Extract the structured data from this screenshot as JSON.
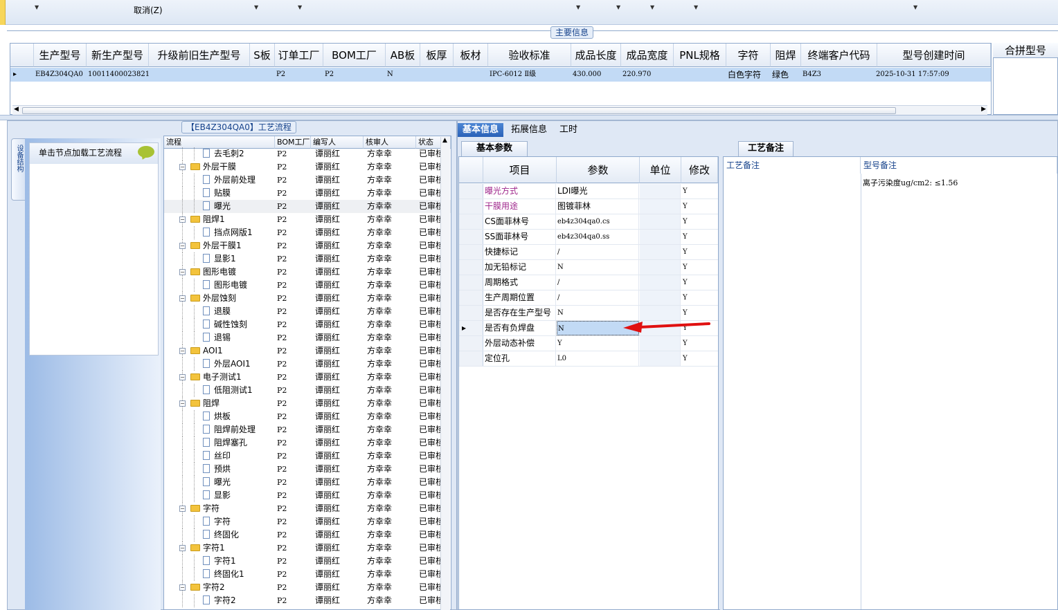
{
  "toolbar": {
    "cancel_label": "取消(Z)"
  },
  "main_info": {
    "caption": "主要信息",
    "columns": [
      "生产型号",
      "新生产型号",
      "升级前旧生产型号",
      "S板",
      "订单工厂",
      "BOM工厂",
      "AB板",
      "板厚",
      "板材",
      "验收标准",
      "成品长度",
      "成品宽度",
      "PNL规格",
      "字符",
      "阻焊",
      "终端客户代码",
      "型号创建时间"
    ],
    "row": {
      "生产型号": "EB4Z304QA0",
      "新生产型号": "10011400023821",
      "升级前旧生产型号": "",
      "S板": "",
      "订单工厂": "P2",
      "BOM工厂": "P2",
      "AB板": "N",
      "板厚": "",
      "板材": "",
      "验收标准": "IPC-6012 Ⅱ级",
      "成品长度": "430.000",
      "成品宽度": "220.970",
      "PNL规格": "",
      "字符": "白色字符",
      "阻焊": "绿色",
      "终端客户代码": "B4Z3",
      "型号创建时间": "2025-10-31 17:57:09"
    },
    "merge_title": "合拼型号"
  },
  "left_panel": {
    "vertical_tab": "设备结构",
    "hint": "单击节点加载工艺流程",
    "tree_caption": "【EB4Z304QA0】工艺流程",
    "tree_columns": [
      "流程",
      "BOM工厂",
      "编写人",
      "核审人",
      "状态"
    ],
    "tree_rows": [
      {
        "name": "去毛刺2",
        "level": 2,
        "bom": "P2",
        "writer": "谭丽红",
        "reviewer": "方幸幸",
        "status": "已审核"
      },
      {
        "name": "外层干膜",
        "level": 1,
        "bom": "P2",
        "writer": "谭丽红",
        "reviewer": "方幸幸",
        "status": "已审核"
      },
      {
        "name": "外层前处理",
        "level": 2,
        "bom": "P2",
        "writer": "谭丽红",
        "reviewer": "方幸幸",
        "status": "已审核"
      },
      {
        "name": "贴膜",
        "level": 2,
        "bom": "P2",
        "writer": "谭丽红",
        "reviewer": "方幸幸",
        "status": "已审核"
      },
      {
        "name": "曝光",
        "level": 2,
        "bom": "P2",
        "writer": "谭丽红",
        "reviewer": "方幸幸",
        "status": "已审核"
      },
      {
        "name": "阻焊1",
        "level": 1,
        "bom": "P2",
        "writer": "谭丽红",
        "reviewer": "方幸幸",
        "status": "已审核"
      },
      {
        "name": "挡点网版1",
        "level": 2,
        "bom": "P2",
        "writer": "谭丽红",
        "reviewer": "方幸幸",
        "status": "已审核"
      },
      {
        "name": "外层干膜1",
        "level": 1,
        "bom": "P2",
        "writer": "谭丽红",
        "reviewer": "方幸幸",
        "status": "已审核"
      },
      {
        "name": "显影1",
        "level": 2,
        "bom": "P2",
        "writer": "谭丽红",
        "reviewer": "方幸幸",
        "status": "已审核"
      },
      {
        "name": "图形电镀",
        "level": 1,
        "bom": "P2",
        "writer": "谭丽红",
        "reviewer": "方幸幸",
        "status": "已审核"
      },
      {
        "name": "图形电镀",
        "level": 2,
        "bom": "P2",
        "writer": "谭丽红",
        "reviewer": "方幸幸",
        "status": "已审核"
      },
      {
        "name": "外层蚀刻",
        "level": 1,
        "bom": "P2",
        "writer": "谭丽红",
        "reviewer": "方幸幸",
        "status": "已审核"
      },
      {
        "name": "退膜",
        "level": 2,
        "bom": "P2",
        "writer": "谭丽红",
        "reviewer": "方幸幸",
        "status": "已审核"
      },
      {
        "name": "碱性蚀刻",
        "level": 2,
        "bom": "P2",
        "writer": "谭丽红",
        "reviewer": "方幸幸",
        "status": "已审核"
      },
      {
        "name": "退锡",
        "level": 2,
        "bom": "P2",
        "writer": "谭丽红",
        "reviewer": "方幸幸",
        "status": "已审核"
      },
      {
        "name": "AOI1",
        "level": 1,
        "bom": "P2",
        "writer": "谭丽红",
        "reviewer": "方幸幸",
        "status": "已审核"
      },
      {
        "name": "外层AOI1",
        "level": 2,
        "bom": "P2",
        "writer": "谭丽红",
        "reviewer": "方幸幸",
        "status": "已审核"
      },
      {
        "name": "电子测试1",
        "level": 1,
        "bom": "P2",
        "writer": "谭丽红",
        "reviewer": "方幸幸",
        "status": "已审核"
      },
      {
        "name": "低阻测试1",
        "level": 2,
        "bom": "P2",
        "writer": "谭丽红",
        "reviewer": "方幸幸",
        "status": "已审核"
      },
      {
        "name": "阻焊",
        "level": 1,
        "bom": "P2",
        "writer": "谭丽红",
        "reviewer": "方幸幸",
        "status": "已审核"
      },
      {
        "name": "烘板",
        "level": 2,
        "bom": "P2",
        "writer": "谭丽红",
        "reviewer": "方幸幸",
        "status": "已审核"
      },
      {
        "name": "阻焊前处理",
        "level": 2,
        "bom": "P2",
        "writer": "谭丽红",
        "reviewer": "方幸幸",
        "status": "已审核"
      },
      {
        "name": "阻焊塞孔",
        "level": 2,
        "bom": "P2",
        "writer": "谭丽红",
        "reviewer": "方幸幸",
        "status": "已审核"
      },
      {
        "name": "丝印",
        "level": 2,
        "bom": "P2",
        "writer": "谭丽红",
        "reviewer": "方幸幸",
        "status": "已审核"
      },
      {
        "name": "预烘",
        "level": 2,
        "bom": "P2",
        "writer": "谭丽红",
        "reviewer": "方幸幸",
        "status": "已审核"
      },
      {
        "name": "曝光",
        "level": 2,
        "bom": "P2",
        "writer": "谭丽红",
        "reviewer": "方幸幸",
        "status": "已审核"
      },
      {
        "name": "显影",
        "level": 2,
        "bom": "P2",
        "writer": "谭丽红",
        "reviewer": "方幸幸",
        "status": "已审核"
      },
      {
        "name": "字符",
        "level": 1,
        "bom": "P2",
        "writer": "谭丽红",
        "reviewer": "方幸幸",
        "status": "已审核"
      },
      {
        "name": "字符",
        "level": 2,
        "bom": "P2",
        "writer": "谭丽红",
        "reviewer": "方幸幸",
        "status": "已审核"
      },
      {
        "name": "终固化",
        "level": 2,
        "bom": "P2",
        "writer": "谭丽红",
        "reviewer": "方幸幸",
        "status": "已审核"
      },
      {
        "name": "字符1",
        "level": 1,
        "bom": "P2",
        "writer": "谭丽红",
        "reviewer": "方幸幸",
        "status": "已审核"
      },
      {
        "name": "字符1",
        "level": 2,
        "bom": "P2",
        "writer": "谭丽红",
        "reviewer": "方幸幸",
        "status": "已审核"
      },
      {
        "name": "终固化1",
        "level": 2,
        "bom": "P2",
        "writer": "谭丽红",
        "reviewer": "方幸幸",
        "status": "已审核"
      },
      {
        "name": "字符2",
        "level": 1,
        "bom": "P2",
        "writer": "谭丽红",
        "reviewer": "方幸幸",
        "status": "已审核"
      },
      {
        "name": "字符2",
        "level": 2,
        "bom": "P2",
        "writer": "谭丽红",
        "reviewer": "方幸幸",
        "status": "已审核"
      }
    ]
  },
  "right_panel": {
    "tabs": [
      "基本信息",
      "拓展信息",
      "工时"
    ],
    "active_tab": "基本信息",
    "subtab_params": "基本参数",
    "subtab_notes": "工艺备注",
    "param_columns": [
      "项目",
      "参数",
      "单位",
      "修改"
    ],
    "params": [
      {
        "item": "曝光方式",
        "value": "LDI曝光",
        "unit": "",
        "edit": "Y",
        "highlight": true
      },
      {
        "item": "干膜用途",
        "value": "图镀菲林",
        "unit": "",
        "edit": "Y",
        "highlight": true
      },
      {
        "item": "CS面菲林号",
        "value": "eb4z304qa0.cs",
        "unit": "",
        "edit": "Y",
        "highlight": false
      },
      {
        "item": "SS面菲林号",
        "value": "eb4z304qa0.ss",
        "unit": "",
        "edit": "Y",
        "highlight": false
      },
      {
        "item": "快捷标记",
        "value": "/",
        "unit": "",
        "edit": "Y",
        "highlight": false
      },
      {
        "item": "加无铅标记",
        "value": "N",
        "unit": "",
        "edit": "Y",
        "highlight": false
      },
      {
        "item": "周期格式",
        "value": "/",
        "unit": "",
        "edit": "Y",
        "highlight": false
      },
      {
        "item": "生产周期位置",
        "value": "/",
        "unit": "",
        "edit": "Y",
        "highlight": false
      },
      {
        "item": "是否存在生产型号",
        "value": "N",
        "unit": "",
        "edit": "Y",
        "highlight": false
      },
      {
        "item": "是否有负焊盘",
        "value": "N",
        "unit": "",
        "edit": "Y",
        "highlight": false,
        "current": true
      },
      {
        "item": "外层动态补偿",
        "value": "Y",
        "unit": "",
        "edit": "Y",
        "highlight": false
      },
      {
        "item": "定位孔",
        "value": "L0",
        "unit": "",
        "edit": "Y",
        "highlight": false
      }
    ],
    "note_columns": [
      "工艺备注",
      "型号备注"
    ],
    "model_note": "离子污染度ug/cm2: ≤1.56",
    "colors": {
      "highlight_text": "#a0288c",
      "arrow": "#e01010",
      "selected_row": "#c2daf5"
    }
  }
}
